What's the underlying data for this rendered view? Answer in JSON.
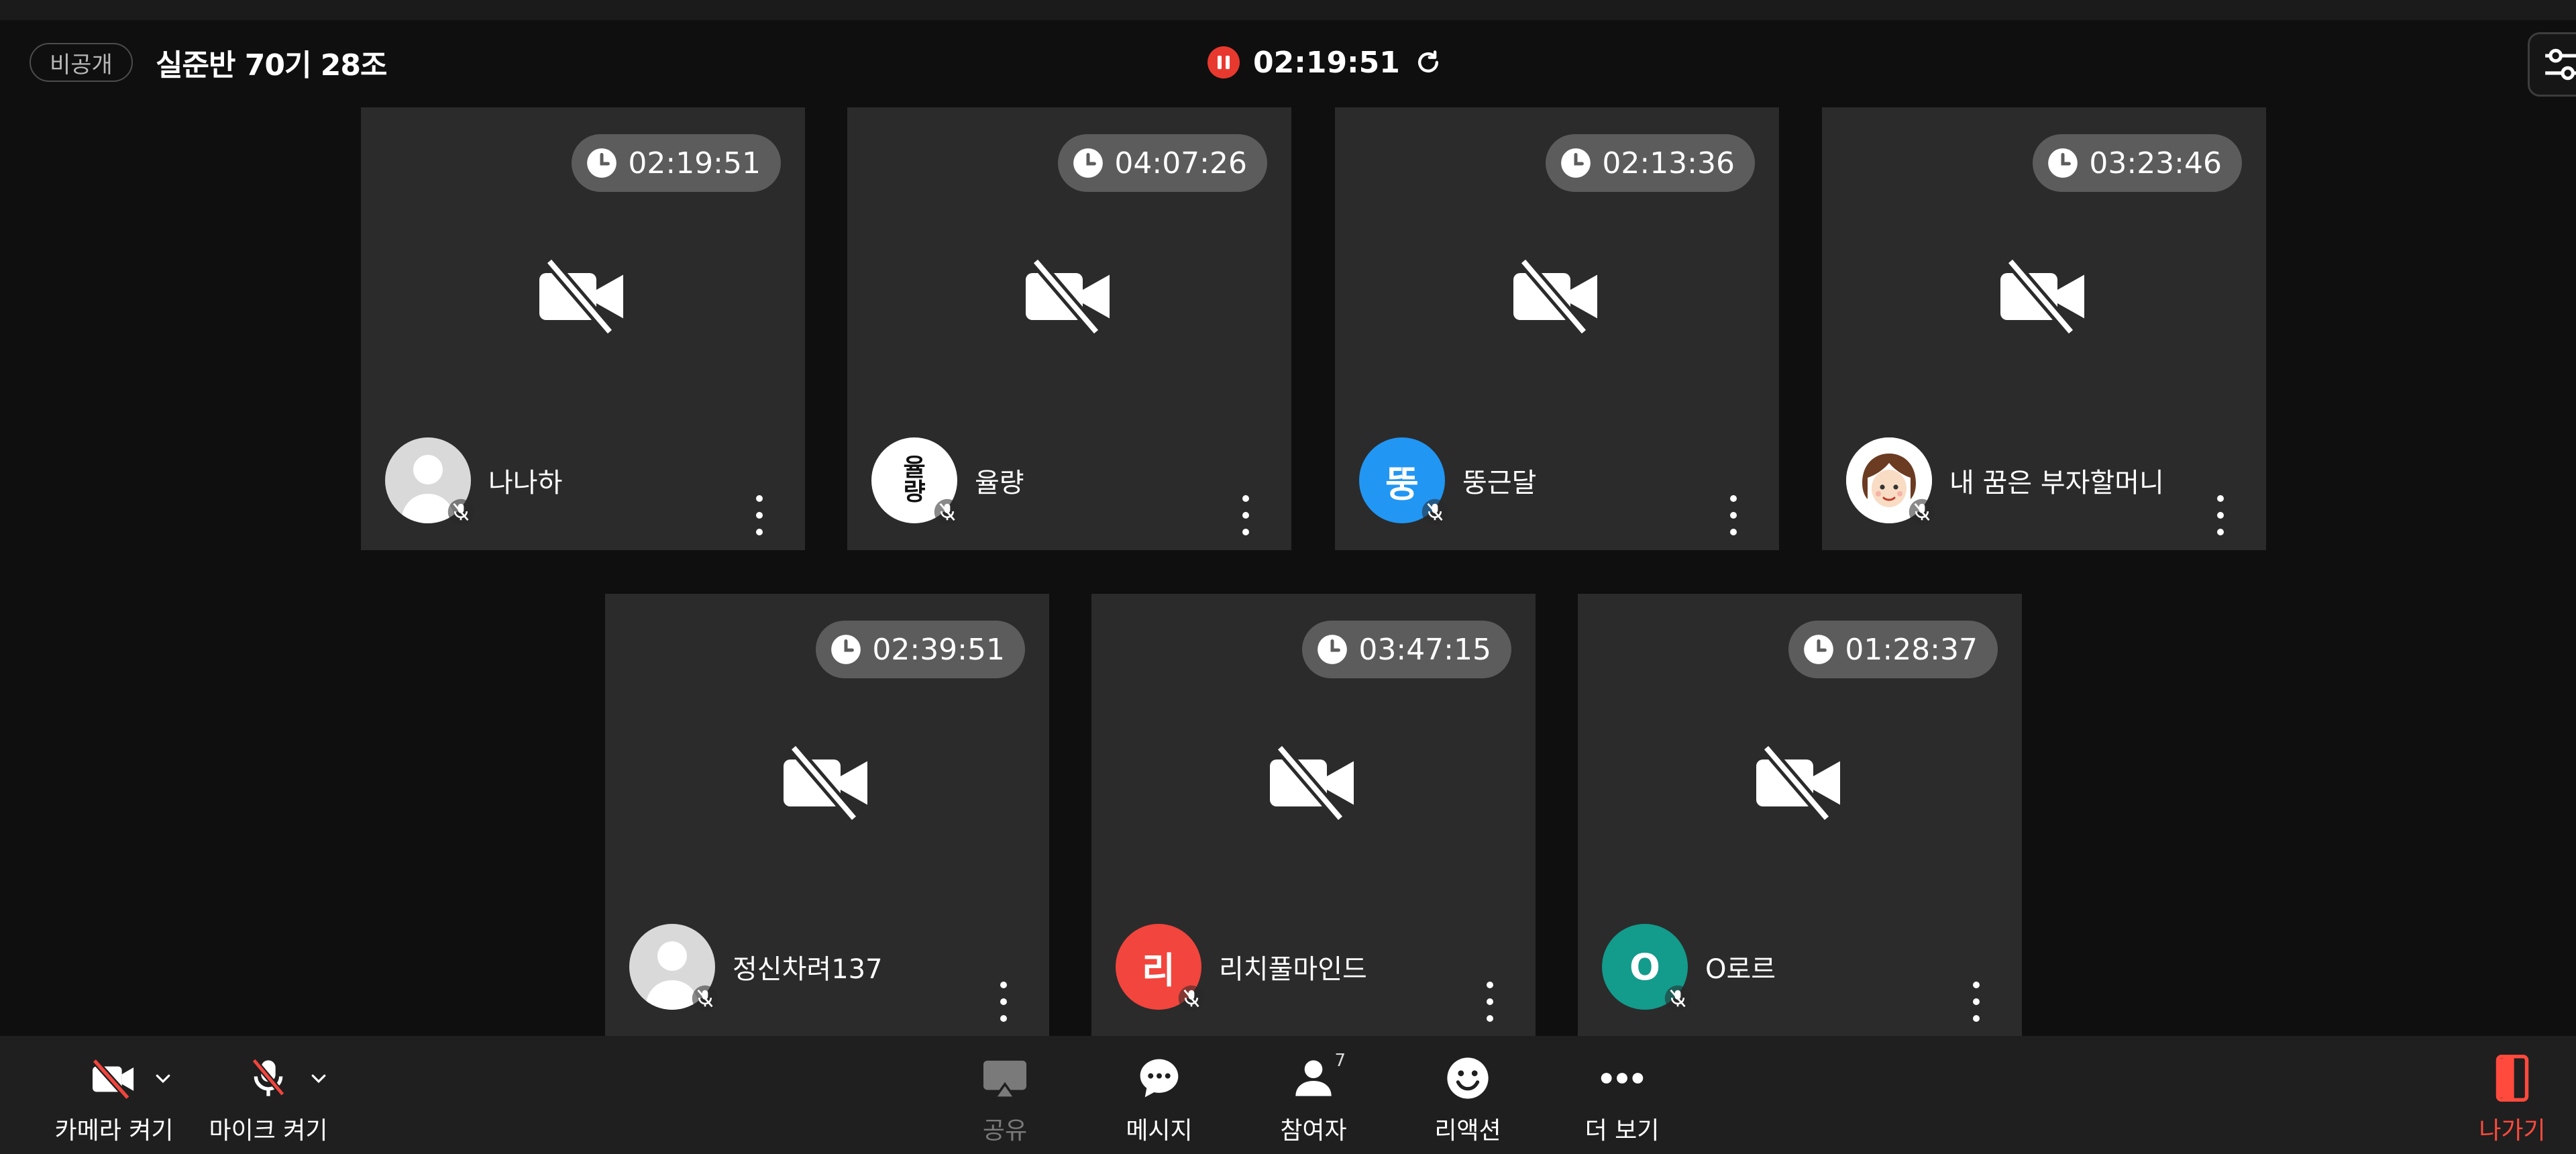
{
  "header": {
    "badge": "비공개",
    "title": "실준반 70기 28조",
    "recording_time": "02:19:51"
  },
  "participants": [
    {
      "name": "나나하",
      "time": "02:19:51",
      "avatar": {
        "type": "default-person",
        "bg": "#d9d9d9"
      }
    },
    {
      "name": "율량",
      "time": "04:07:26",
      "avatar": {
        "type": "text",
        "text": "율\n량",
        "bg": "#ffffff"
      }
    },
    {
      "name": "뚱근달",
      "time": "02:13:36",
      "avatar": {
        "type": "letter",
        "text": "뚱",
        "bg": "#2196f3"
      }
    },
    {
      "name": "내 꿈은 부자할머니",
      "time": "03:23:46",
      "avatar": {
        "type": "cartoon",
        "bg": "#ffffff"
      }
    },
    {
      "name": "정신차려137",
      "time": "02:39:51",
      "avatar": {
        "type": "default-person",
        "bg": "#d9d9d9"
      }
    },
    {
      "name": "리치풀마인드",
      "time": "03:47:15",
      "avatar": {
        "type": "letter",
        "text": "리",
        "bg": "#f2453d"
      }
    },
    {
      "name": "O로르",
      "time": "01:28:37",
      "avatar": {
        "type": "letter",
        "text": "O",
        "bg": "#139b8c"
      }
    }
  ],
  "toolbar": {
    "camera_label": "카메라 켜기",
    "mic_label": "마이크 켜기",
    "share_label": "공유",
    "message_label": "메시지",
    "participants_label": "참여자",
    "participants_count": "7",
    "reaction_label": "리액션",
    "more_label": "더 보기",
    "exit_label": "나가기"
  },
  "colors": {
    "background": "#0f0f0f",
    "tile": "#2b2b2b",
    "recording": "#e8392f",
    "exit": "#ff4a3d"
  }
}
